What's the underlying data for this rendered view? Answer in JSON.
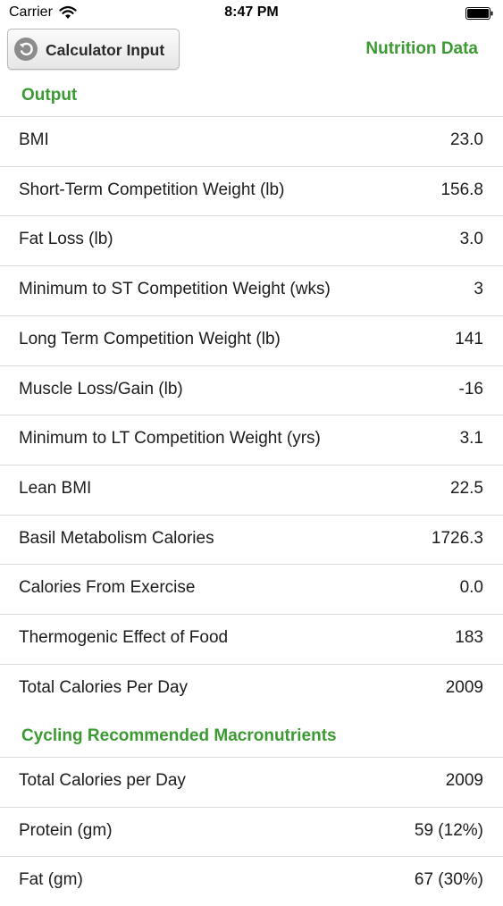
{
  "status_bar": {
    "carrier": "Carrier",
    "time": "8:47 PM"
  },
  "nav": {
    "back_label": "Calculator Input",
    "title": "Nutrition Data"
  },
  "output": {
    "header": "Output",
    "rows": [
      {
        "label": "BMI",
        "value": "23.0"
      },
      {
        "label": "Short-Term Competition Weight (lb)",
        "value": "156.8"
      },
      {
        "label": "Fat Loss (lb)",
        "value": "3.0"
      },
      {
        "label": "Minimum to ST Competition Weight (wks)",
        "value": "3"
      },
      {
        "label": "Long Term Competition Weight (lb)",
        "value": "141"
      },
      {
        "label": "Muscle Loss/Gain (lb)",
        "value": "-16"
      },
      {
        "label": "Minimum to LT Competition Weight (yrs)",
        "value": "3.1"
      },
      {
        "label": "Lean BMI",
        "value": "22.5"
      },
      {
        "label": "Basil Metabolism Calories",
        "value": "1726.3"
      },
      {
        "label": "Calories From Exercise",
        "value": "0.0"
      },
      {
        "label": "Thermogenic Effect of Food",
        "value": "183"
      },
      {
        "label": "Total Calories Per Day",
        "value": "2009"
      }
    ]
  },
  "macros": {
    "header": "Cycling Recommended Macronutrients",
    "rows": [
      {
        "label": "Total Calories per Day",
        "value": "2009"
      },
      {
        "label": "Protein (gm)",
        "value": "59 (12%)"
      },
      {
        "label": "Fat (gm)",
        "value": "67 (30%)"
      }
    ]
  },
  "colors": {
    "accent_green": "#3b9a32",
    "separator": "#dcdcdc"
  },
  "icons": {
    "back": "back-arrow-circle-icon",
    "wifi": "wifi-icon",
    "battery": "battery-icon"
  }
}
